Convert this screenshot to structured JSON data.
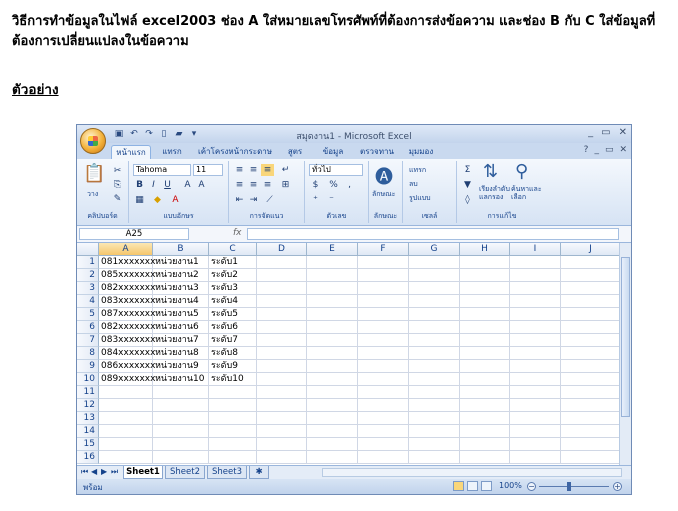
{
  "document": {
    "intro": "วิธีการทำข้อมูลในไฟล์ excel2003  ช่อง A ใส่หมายเลขโทรศัพท์ที่ต้องการส่งข้อความ และช่อง B กับ C ใส่ข้อมูลที่ต้องการเปลี่ยนแปลงในข้อความ",
    "example_heading": "ตัวอย่าง"
  },
  "window": {
    "title": "สมุดงาน1 - Microsoft Excel",
    "controls": [
      "_",
      "▭",
      "✕"
    ]
  },
  "ribbon_tabs": [
    "หน้าแรก",
    "แทรก",
    "เค้าโครงหน้ากระดาษ",
    "สูตร",
    "ข้อมูล",
    "ตรวจทาน",
    "มุมมอง"
  ],
  "ribbon": {
    "font_name": "Tahoma",
    "font_size": "11",
    "number_format": "ทั่วไป",
    "groups": [
      "คลิปบอร์ด",
      "แบบอักษร",
      "การจัดแนว",
      "ตัวเลข",
      "ลักษณะ",
      "เซลล์",
      "การแก้ไข"
    ],
    "paste_label": "วาง",
    "style_label": "ลักษณะ",
    "insert_label": "แทรก",
    "delete_label": "ลบ",
    "format_label": "รูปแบบ",
    "sort_label": "เรียงลำดับ\nแลกรอง",
    "find_label": "ค้นหาและ\nเลือก",
    "bold": "B",
    "italic": "I",
    "underline": "U",
    "currency": "$",
    "percent": "%",
    "comma": ","
  },
  "formula_bar": {
    "name_box": "A25",
    "fx": "fx",
    "formula": ""
  },
  "sheet": {
    "columns": [
      "A",
      "B",
      "C",
      "D",
      "E",
      "F",
      "G",
      "H",
      "I",
      "J"
    ],
    "rows": [
      "1",
      "2",
      "3",
      "4",
      "5",
      "6",
      "7",
      "8",
      "9",
      "10",
      "11",
      "12",
      "13",
      "14",
      "15",
      "16"
    ],
    "data": [
      [
        "081xxxxxxx",
        "หน่วยงาน1",
        "ระดับ1"
      ],
      [
        "085xxxxxxx",
        "หน่วยงาน2",
        "ระดับ2"
      ],
      [
        "082xxxxxxx",
        "หน่วยงาน3",
        "ระดับ3"
      ],
      [
        "083xxxxxxx",
        "หน่วยงาน4",
        "ระดับ4"
      ],
      [
        "087xxxxxxx",
        "หน่วยงาน5",
        "ระดับ5"
      ],
      [
        "082xxxxxxx",
        "หน่วยงาน6",
        "ระดับ6"
      ],
      [
        "083xxxxxxx",
        "หน่วยงาน7",
        "ระดับ7"
      ],
      [
        "084xxxxxxx",
        "หน่วยงาน8",
        "ระดับ8"
      ],
      [
        "086xxxxxxx",
        "หน่วยงาน9",
        "ระดับ9"
      ],
      [
        "089xxxxxxx",
        "หน่วยงาน10",
        "ระดับ10"
      ]
    ],
    "selected_column": "A"
  },
  "sheet_tabs": [
    "Sheet1",
    "Sheet2",
    "Sheet3"
  ],
  "status": {
    "ready": "พร้อม",
    "zoom": "100%"
  }
}
